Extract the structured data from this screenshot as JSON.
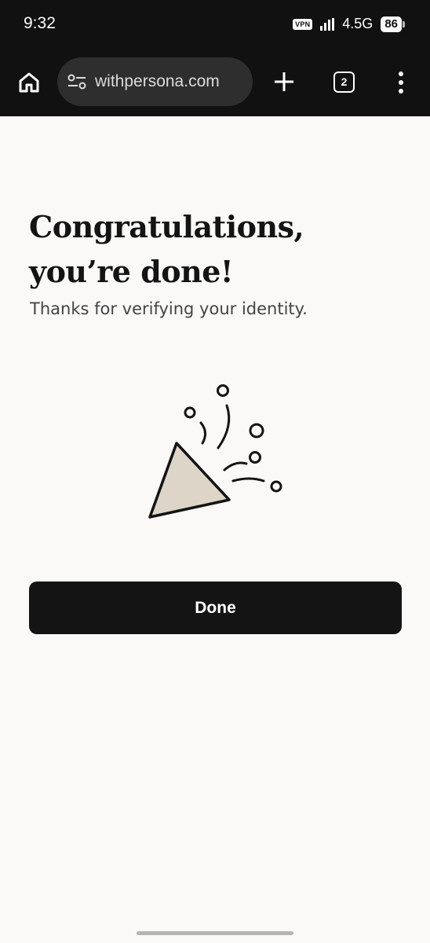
{
  "status_bar": {
    "time": "9:32",
    "vpn_label": "VPN",
    "network": "4.5G",
    "battery": "86"
  },
  "browser": {
    "url": "withpersona.com",
    "tab_count": "2"
  },
  "page": {
    "heading": "Congratulations, you’re done!",
    "subtitle": "Thanks for verifying your identity.",
    "done_button": "Done"
  },
  "icons": [
    "home-icon",
    "site-settings-icon",
    "new-tab-icon",
    "tab-switcher-icon",
    "more-menu-icon",
    "party-popper-icon"
  ],
  "colors": {
    "background": "#faf9f7",
    "chrome": "#111111",
    "button": "#141414",
    "popper_fill": "#ddd5c8"
  }
}
